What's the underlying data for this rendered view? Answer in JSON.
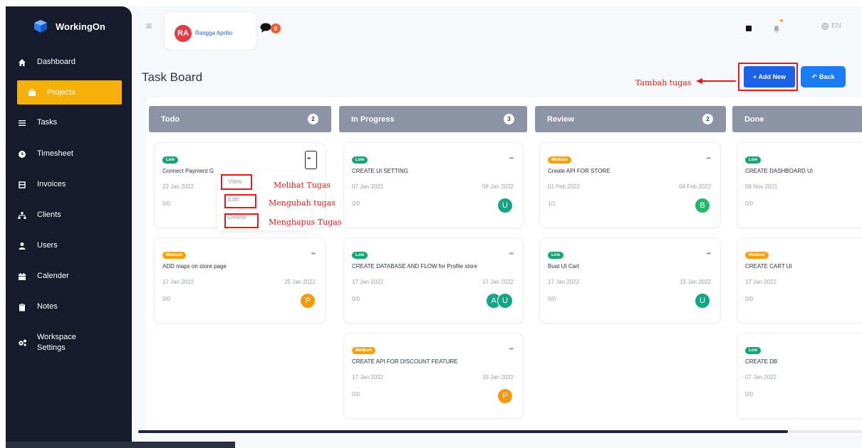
{
  "app": {
    "name": "WorkingOn"
  },
  "sidebar": {
    "items": [
      {
        "label": "Dashboard",
        "icon": "home-icon",
        "active": false
      },
      {
        "label": "Projects",
        "icon": "briefcase-icon",
        "active": true
      },
      {
        "label": "Tasks",
        "icon": "list-icon",
        "active": false
      },
      {
        "label": "Timesheet",
        "icon": "clock-icon",
        "active": false
      },
      {
        "label": "Invoices",
        "icon": "invoice-icon",
        "active": false
      },
      {
        "label": "Clients",
        "icon": "sitemap-icon",
        "active": false
      },
      {
        "label": "Users",
        "icon": "user-icon",
        "active": false
      },
      {
        "label": "Calender",
        "icon": "calendar-icon",
        "active": false
      },
      {
        "label": "Notes",
        "icon": "clipboard-icon",
        "active": false
      },
      {
        "label": "Workspace\nSettings",
        "icon": "cogs-icon",
        "active": false
      }
    ]
  },
  "header": {
    "user_initials": "RA",
    "user_name": "Rangga Aprilio",
    "chat_count": "0",
    "language": "EN"
  },
  "page": {
    "title": "Task Board",
    "add_button": "+ Add New",
    "back_button": "Back"
  },
  "annotations": {
    "add": "Tambah tugas",
    "view": "Melihat Tugas",
    "edit": "Mengubah tugas",
    "delete": "Menghapus Tugas"
  },
  "card_menu": {
    "view": "View",
    "edit": "Edit",
    "delete": "Delete"
  },
  "columns": [
    {
      "name": "Todo",
      "count": "2",
      "cards": [
        {
          "priority": "Low",
          "title": "Connect Payment G",
          "start": "22 Jan 2022",
          "end": "",
          "progress": "0/0",
          "avatars": []
        },
        {
          "priority": "Medium",
          "title": "ADD maps on store page",
          "start": "17 Jan 2022",
          "end": "25 Jan 2022",
          "progress": "0/0",
          "avatars": [
            "P"
          ]
        }
      ]
    },
    {
      "name": "In Progress",
      "count": "3",
      "cards": [
        {
          "priority": "Low",
          "title": "CREATE UI SETTING",
          "start": "07 Jan 2022",
          "end": "08 Jan 2022",
          "progress": "0/0",
          "avatars": [
            "U"
          ]
        },
        {
          "priority": "Low",
          "title": "CREATE DATABASE AND FLOW for Profile store",
          "start": "17 Jan 2022",
          "end": "17 Jan 2022",
          "progress": "0/0",
          "avatars": [
            "A",
            "U"
          ]
        },
        {
          "priority": "Medium",
          "title": "CREATE API FOR DISCOUNT FEATURE",
          "start": "17 Jan 2022",
          "end": "19 Jan 2022",
          "progress": "0/0",
          "avatars": [
            "P"
          ]
        }
      ]
    },
    {
      "name": "Review",
      "count": "2",
      "cards": [
        {
          "priority": "Medium",
          "title": "Create API FOR STORE",
          "start": "01 Feb 2022",
          "end": "04 Feb 2022",
          "progress": "1/1",
          "avatars": [
            "B"
          ]
        },
        {
          "priority": "Low",
          "title": "Buat UI Cart",
          "start": "17 Jan 2022",
          "end": "19 Jan 2022",
          "progress": "0/0",
          "avatars": [
            "U"
          ]
        }
      ]
    },
    {
      "name": "Done",
      "count": "",
      "cards": [
        {
          "priority": "Low",
          "title": "CREATE DASHBOARD UI",
          "start": "08 Nov 2021",
          "end": "",
          "progress": "0/0",
          "avatars": []
        },
        {
          "priority": "Medium",
          "title": "CREATE CART UI",
          "start": "17 Jan 2022",
          "end": "",
          "progress": "0/0",
          "avatars": []
        },
        {
          "priority": "Low",
          "title": "CREATE DB",
          "start": "07 Jan 2022",
          "end": "",
          "progress": "0/0",
          "avatars": []
        }
      ]
    }
  ],
  "colors": {
    "sidebar": "#161b2b",
    "accent": "#f5b00b",
    "primary": "#1a62e8",
    "annotation": "#e11b1b"
  }
}
